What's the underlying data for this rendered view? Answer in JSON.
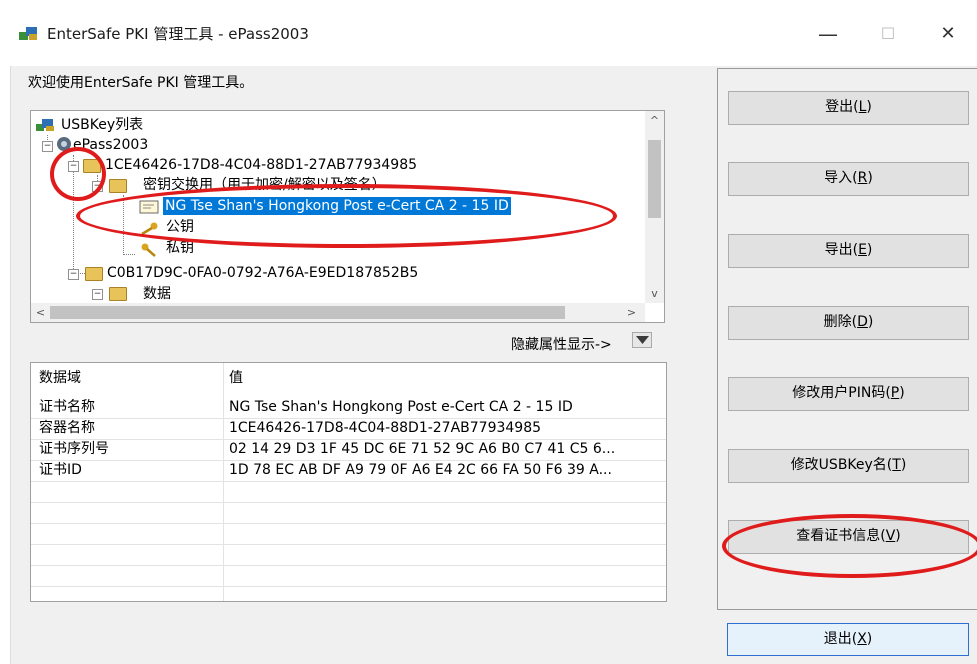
{
  "window": {
    "title": "EnterSafe PKI 管理工具 - ePass2003",
    "minimize": "—",
    "maximize": "☐",
    "close": "✕"
  },
  "welcome": "欢迎使用EnterSafe PKI 管理工具。",
  "tree": {
    "root": "USBKey列表",
    "device": "ePass2003",
    "container1": "1CE46426-17D8-4C04-88D1-27AB77934985",
    "keyexchange": "密钥交换用（用于加密/解密以及签名）",
    "certificate": "NG Tse Shan's Hongkong Post e-Cert CA 2 - 15 ID",
    "publickey": "公钥",
    "privatekey": "私钥",
    "container2": "C0B17D9C-0FA0-0792-A76A-E9ED187852B5",
    "data": "数据"
  },
  "toggle_label": "隐藏属性显示->",
  "props": {
    "header": {
      "field": "数据域",
      "value": "值"
    },
    "rows": [
      {
        "field": "证书名称",
        "value": "NG Tse Shan's Hongkong Post e-Cert CA 2 - 15 ID"
      },
      {
        "field": "容器名称",
        "value": "1CE46426-17D8-4C04-88D1-27AB77934985"
      },
      {
        "field": "证书序列号",
        "value": "02 14 29 D3 1F 45 DC 6E 71 52 9C A6 B0 C7 41 C5 6..."
      },
      {
        "field": "证书ID",
        "value": "1D 78 EC AB DF A9 79 0F A6 E4 2C 66 FA 50 F6 39 A..."
      }
    ]
  },
  "buttons": {
    "logout": {
      "text": "登出(",
      "key": "L",
      "end": ")"
    },
    "import": {
      "text": "导入(",
      "key": "R",
      "end": ")"
    },
    "export": {
      "text": "导出(",
      "key": "E",
      "end": ")"
    },
    "delete": {
      "text": "删除(",
      "key": "D",
      "end": ")"
    },
    "change_pin": {
      "text": "修改用户PIN码(",
      "key": "P",
      "end": ")"
    },
    "rename": {
      "text": "修改USBKey名(",
      "key": "T",
      "end": ")"
    },
    "view_cert": {
      "text": "查看证书信息(",
      "key": "V",
      "end": ")"
    },
    "exit": {
      "text": "退出(",
      "key": "X",
      "end": ")"
    }
  },
  "colors": {
    "annotation": "#e01b1b",
    "selection": "#0078d7"
  }
}
